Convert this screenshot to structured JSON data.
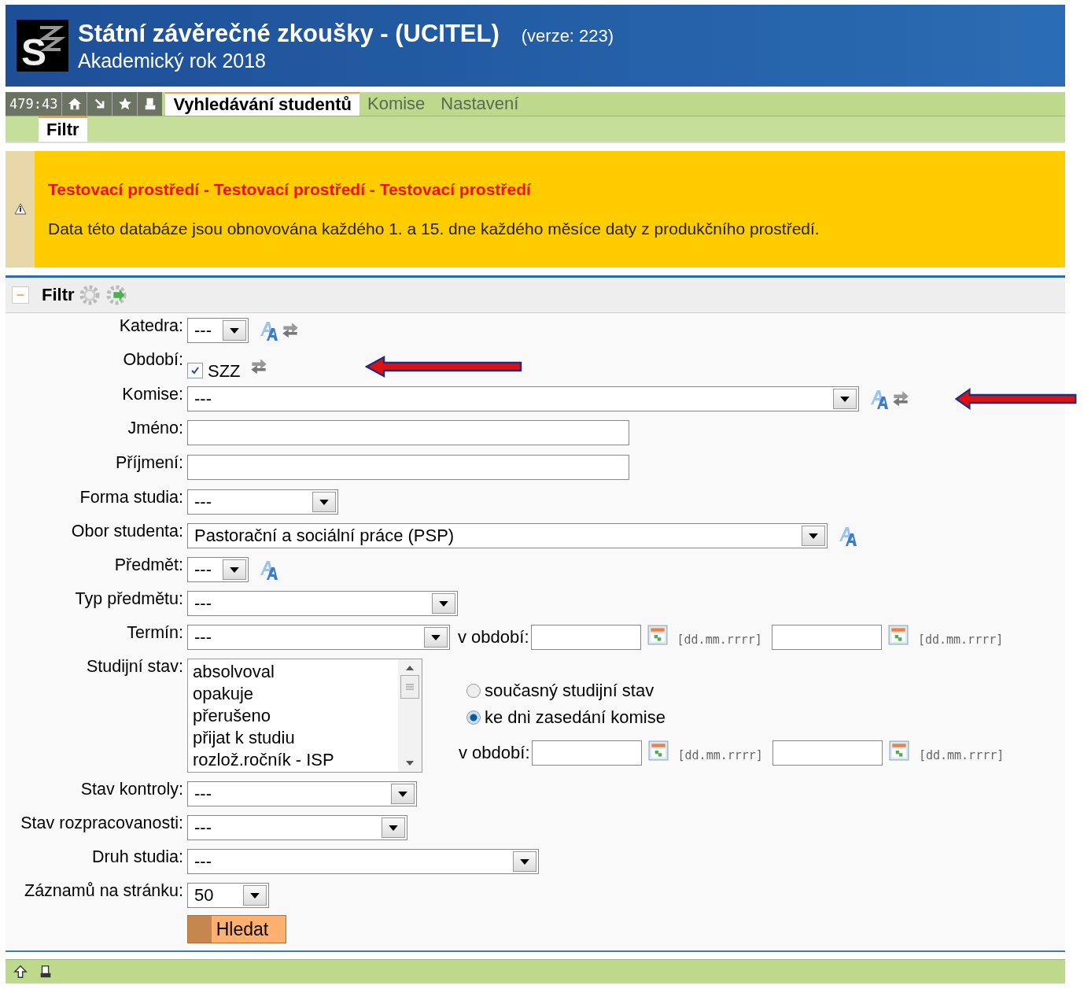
{
  "header": {
    "title": "Státní závěrečné zkoušky - (UCITEL)",
    "version": "(verze: 223)",
    "subtitle": "Akademický rok 2018",
    "logo_letter": "S"
  },
  "toolbar": {
    "timer": "479:43",
    "tabs": [
      {
        "label": "Vyhledávání studentů",
        "selected": true
      },
      {
        "label": "Komise",
        "selected": false
      },
      {
        "label": "Nastavení",
        "selected": false
      }
    ]
  },
  "subtabs": [
    {
      "label": "Filtr",
      "selected": true
    }
  ],
  "notice": {
    "title": "Testovací prostředí - Testovací prostředí - Testovací prostředí",
    "text": "Data této databáze jsou obnovována každého 1. a 15. dne každého měsíce daty z produkčního prostředí."
  },
  "filter": {
    "title": "Filtr",
    "expanded": true,
    "fields": [
      {
        "kind": "select",
        "label": "Katedra:",
        "value": "---",
        "lang_toggle": true,
        "swap_toggle": true,
        "arrow": false
      },
      {
        "kind": "checkbox",
        "label": "Období:",
        "option": "SZZ",
        "checked": true,
        "swap_toggle": true,
        "arrow": true
      },
      {
        "kind": "select",
        "label": "Komise:",
        "value": "---",
        "lang_toggle": true,
        "swap_toggle": true,
        "arrow": true
      },
      {
        "kind": "text",
        "label": "Jméno:"
      },
      {
        "kind": "text",
        "label": "Příjmení:"
      },
      {
        "kind": "select",
        "label": "Forma studia:",
        "value": "---"
      },
      {
        "kind": "select",
        "label": "Obor studenta:",
        "value": "Pastorační a sociální práce (PSP)",
        "lang_toggle": true
      },
      {
        "kind": "select",
        "label": "Předmět:",
        "value": "---",
        "lang_toggle": true
      },
      {
        "kind": "select",
        "label": "Typ předmětu:",
        "value": "---"
      },
      {
        "kind": "select",
        "label": "Termín:",
        "value": "---",
        "period": {
          "label": "v období:",
          "dates": [
            {
              "format": "[dd.mm.rrrr]"
            },
            {
              "format": "[dd.mm.rrrr]"
            }
          ]
        }
      },
      {
        "kind": "listbox",
        "label": "Studijní stav:",
        "options": [
          "absolvoval",
          "opakuje",
          "přerušeno",
          "přijat k studiu",
          "rozlož.ročník - ISP"
        ],
        "radios": [
          {
            "label": "současný studijní stav",
            "selected": false
          },
          {
            "label": "ke dni zasedání komise",
            "selected": true
          }
        ],
        "period": {
          "label": "v období:",
          "dates": [
            {
              "format": "[dd.mm.rrrr]"
            },
            {
              "format": "[dd.mm.rrrr]"
            }
          ]
        }
      },
      {
        "kind": "select",
        "label": "Stav kontroly:",
        "value": "---"
      },
      {
        "kind": "select",
        "label": "Stav rozpracovanosti:",
        "value": "---"
      },
      {
        "kind": "select",
        "label": "Druh studia:",
        "value": "---"
      },
      {
        "kind": "select",
        "label": "Záznamů na stránku:",
        "value": "50"
      }
    ],
    "submit": "Hledat"
  }
}
